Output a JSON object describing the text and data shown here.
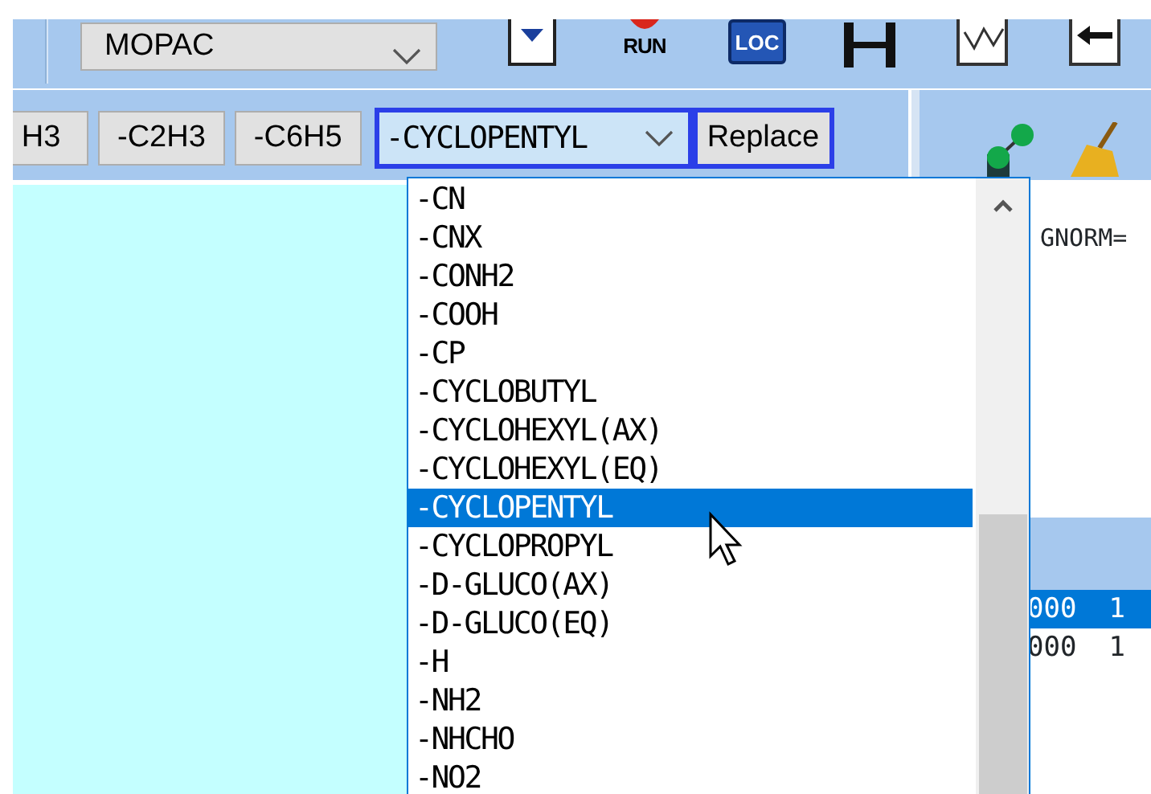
{
  "engine": {
    "value": "MOPAC"
  },
  "toolbar_icons": [
    {
      "kind": "import"
    },
    {
      "kind": "run",
      "label": "RUN"
    },
    {
      "kind": "loc",
      "label": "LOC"
    },
    {
      "kind": "measure"
    },
    {
      "kind": "wave"
    },
    {
      "kind": "back"
    }
  ],
  "substituent_buttons": [
    "H3",
    "-C2H3",
    "-C6H5"
  ],
  "substituent_select": {
    "value": "-CYCLOPENTYL",
    "expanded": true,
    "options": [
      {
        "label": "-CN",
        "selected": false
      },
      {
        "label": "-CNX",
        "selected": false
      },
      {
        "label": "-CONH2",
        "selected": false
      },
      {
        "label": "-COOH",
        "selected": false
      },
      {
        "label": "-CP",
        "selected": false
      },
      {
        "label": "-CYCLOBUTYL",
        "selected": false
      },
      {
        "label": "-CYCLOHEXYL(AX)",
        "selected": false
      },
      {
        "label": "-CYCLOHEXYL(EQ)",
        "selected": false
      },
      {
        "label": "-CYCLOPENTYL",
        "selected": true
      },
      {
        "label": "-CYCLOPROPYL",
        "selected": false
      },
      {
        "label": "-D-GLUCO(AX)",
        "selected": false
      },
      {
        "label": "-D-GLUCO(EQ)",
        "selected": false
      },
      {
        "label": "-H",
        "selected": false
      },
      {
        "label": "-NH2",
        "selected": false
      },
      {
        "label": "-NHCHO",
        "selected": false
      },
      {
        "label": "-NO2",
        "selected": false
      }
    ]
  },
  "replace_button": "Replace",
  "side_tools": [
    {
      "kind": "molecule"
    },
    {
      "kind": "broom"
    }
  ],
  "output": {
    "text": "GNORM="
  },
  "table": {
    "rows": [
      {
        "cells": [
          "000",
          "1"
        ],
        "selected": true
      },
      {
        "cells": [
          "000",
          "1"
        ],
        "selected": false
      }
    ]
  }
}
